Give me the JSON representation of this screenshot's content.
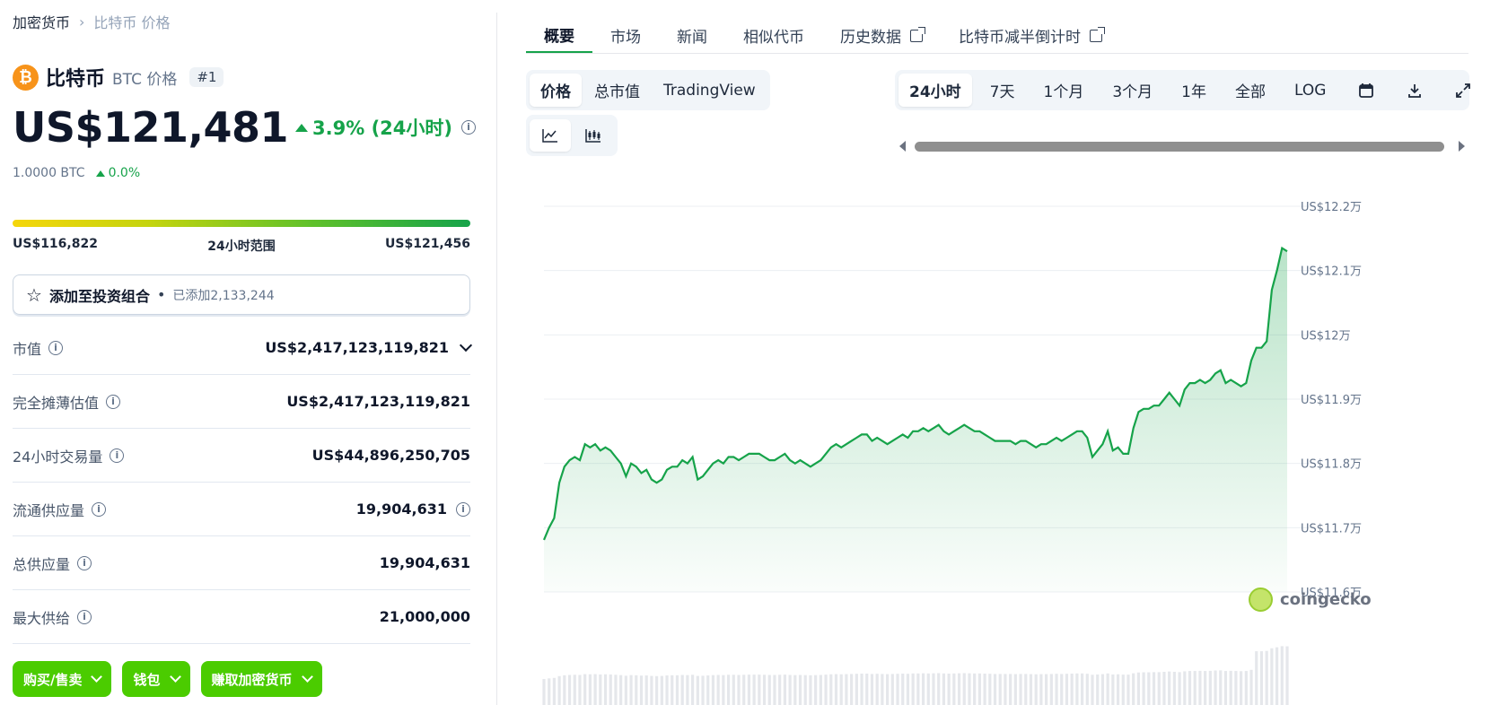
{
  "breadcrumb": {
    "home": "加密货币",
    "current": "比特币 价格"
  },
  "coin": {
    "name": "比特币",
    "symbol": "BTC 价格",
    "rank": "#1",
    "logo_glyph": "₿",
    "logo_color": "#f7931a"
  },
  "price": {
    "value": "US$121,481",
    "change": "3.9% (24小时)",
    "change_color": "#16a34a"
  },
  "btc": {
    "amount": "1.0000 BTC",
    "change": "0.0%"
  },
  "range": {
    "low": "US$116,822",
    "label": "24小时范围",
    "high": "US$121,456"
  },
  "portfolio": {
    "label": "添加至投资组合",
    "dot": "•",
    "added": "已添加2,133,244"
  },
  "stats": [
    {
      "label": "市值",
      "value": "US$2,417,123,119,821"
    },
    {
      "label": "完全摊薄估值",
      "value": "US$2,417,123,119,821"
    },
    {
      "label": "24小时交易量",
      "value": "US$44,896,250,705"
    },
    {
      "label": "流通供应量",
      "value": "19,904,631"
    },
    {
      "label": "总供应量",
      "value": "19,904,631"
    },
    {
      "label": "最大供给",
      "value": "21,000,000"
    }
  ],
  "actions": [
    {
      "label": "购买/售卖"
    },
    {
      "label": "钱包"
    },
    {
      "label": "赚取加密货币"
    }
  ],
  "tabs": [
    {
      "label": "概要",
      "active": true
    },
    {
      "label": "市场"
    },
    {
      "label": "新闻"
    },
    {
      "label": "相似代币"
    },
    {
      "label": "历史数据",
      "external": true
    },
    {
      "label": "比特币减半倒计时",
      "external": true
    }
  ],
  "chart_type_options": [
    "价格",
    "总市值",
    "TradingView"
  ],
  "range_options": [
    "24小时",
    "7天",
    "1个月",
    "3个月",
    "1年",
    "全部",
    "LOG"
  ],
  "toolbar_icons": [
    "calendar-icon",
    "download-icon",
    "fullscreen-icon"
  ],
  "chart_style_icons": [
    "line-chart-icon",
    "candlestick-chart-icon"
  ],
  "watermark": "coingecko",
  "chart_data": {
    "type": "area",
    "title": "",
    "xlabel": "",
    "ylabel": "",
    "yticks": [
      "US$12.2万",
      "US$12.1万",
      "US$12万",
      "US$11.9万",
      "US$11.8万",
      "US$11.7万",
      "US$11.6万"
    ],
    "ylim": [
      116000,
      122000
    ],
    "color": "#16a34a",
    "series": [
      {
        "values": [
          116810,
          117000,
          117150,
          117700,
          117950,
          118050,
          118100,
          118050,
          118300,
          118250,
          118300,
          118200,
          118250,
          118200,
          118100,
          118000,
          117800,
          118000,
          117950,
          117850,
          117900,
          117750,
          117700,
          117750,
          117900,
          117950,
          117950,
          118050,
          118000,
          118100,
          117750,
          117800,
          117900,
          118000,
          118050,
          118000,
          118100,
          118100,
          118050,
          118100,
          118150,
          118150,
          118150,
          118100,
          118050,
          118050,
          118100,
          118150,
          118050,
          118000,
          118050,
          118000,
          117950,
          118000,
          118050,
          118150,
          118250,
          118300,
          118250,
          118300,
          118350,
          118400,
          118450,
          118450,
          118350,
          118400,
          118350,
          118300,
          118350,
          118400,
          118450,
          118400,
          118500,
          118500,
          118550,
          118500,
          118550,
          118600,
          118500,
          118450,
          118500,
          118550,
          118600,
          118550,
          118500,
          118500,
          118450,
          118400,
          118350,
          118350,
          118350,
          118350,
          118300,
          118350,
          118350,
          118300,
          118250,
          118300,
          118300,
          118350,
          118400,
          118350,
          118400,
          118450,
          118500,
          118500,
          118400,
          118100,
          118200,
          118300,
          118500,
          118200,
          118250,
          118150,
          118150,
          118550,
          118800,
          118850,
          118850,
          118900,
          118900,
          119000,
          119100,
          119000,
          118900,
          119150,
          119250,
          119250,
          119300,
          119250,
          119300,
          119400,
          119450,
          119250,
          119300,
          119250,
          119200,
          119250,
          119600,
          119800,
          119800,
          119900,
          120700,
          121000,
          121350,
          121300
        ]
      }
    ]
  }
}
